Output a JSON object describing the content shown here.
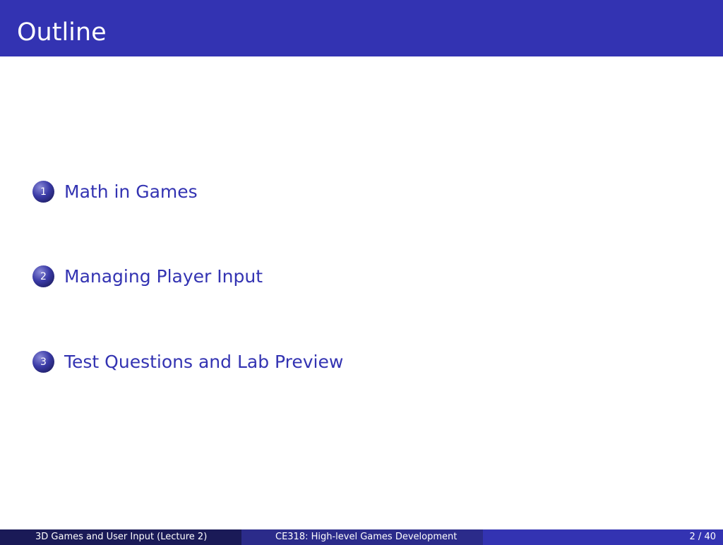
{
  "slide": {
    "title": "Outline"
  },
  "outline": {
    "items": [
      {
        "number": "1",
        "label": "Math in Games"
      },
      {
        "number": "2",
        "label": "Managing Player Input"
      },
      {
        "number": "3",
        "label": "Test Questions and Lab Preview"
      }
    ]
  },
  "footer": {
    "left": "3D Games and User Input  (Lecture 2)",
    "center": "CE318: High-level Games Development",
    "right": "2 / 40"
  },
  "colors": {
    "title_bar": "#3333b2",
    "footer_left": "#1a1a57",
    "footer_mid": "#2b2b8a",
    "footer_right": "#3333b2",
    "item_text": "#3333b2"
  }
}
